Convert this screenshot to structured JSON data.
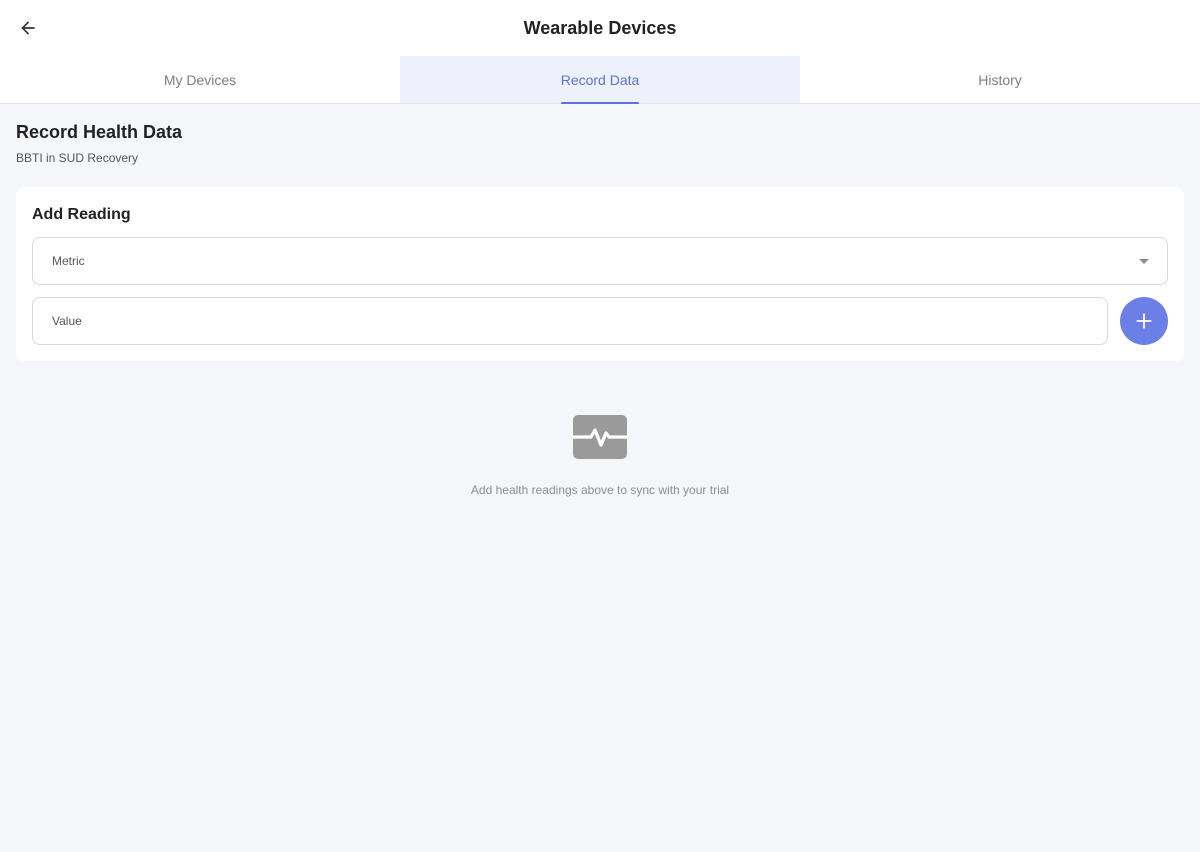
{
  "header": {
    "title": "Wearable Devices",
    "back_icon": "arrow-left-icon"
  },
  "tabs": [
    {
      "label": "My Devices",
      "active": false
    },
    {
      "label": "Record Data",
      "active": true
    },
    {
      "label": "History",
      "active": false
    }
  ],
  "section": {
    "title": "Record Health Data",
    "subtitle": "BBTI in SUD Recovery"
  },
  "form": {
    "title": "Add Reading",
    "metric_label": "Metric",
    "value_placeholder": "Value",
    "add_icon": "plus-icon"
  },
  "empty_state": {
    "icon": "monitor-heart-icon",
    "message": "Add health readings above to sync with your trial"
  },
  "colors": {
    "accent": "#5b72d6",
    "button": "#6c7fe6",
    "background": "#f5f6fa"
  }
}
